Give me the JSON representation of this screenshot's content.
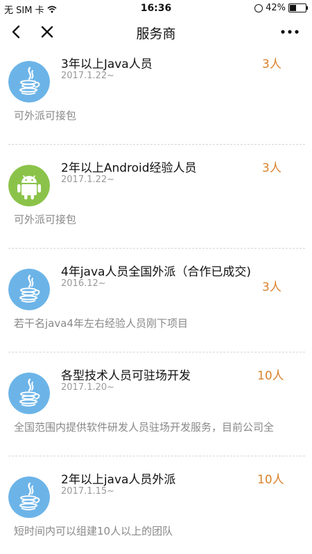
{
  "status_bar": {
    "carrier": "无 SIM 卡",
    "time": "16:36",
    "battery": "42%"
  },
  "nav": {
    "title": "服务商"
  },
  "colors": {
    "count": "#d9822b",
    "java_avatar_bg": "#6cb4e8",
    "android_avatar_bg": "#8bc34a"
  },
  "items": [
    {
      "icon": "java-icon",
      "title": "3年以上Java人员",
      "date": "2017.1.22~",
      "count": "3人",
      "desc": "可外派可接包"
    },
    {
      "icon": "android-icon",
      "title": "2年以上Android经验人员",
      "date": "2017.1.22~",
      "count": "3人",
      "desc": "可外派可接包"
    },
    {
      "icon": "java-icon",
      "title": "4年java人员全国外派（合作已成交)",
      "date": "2016.12~",
      "count": "3人",
      "desc": "若干名java4年左右经验人员刚下项目"
    },
    {
      "icon": "java-icon",
      "title": "各型技术人员可驻场开发",
      "date": "2017.1.20~",
      "count": "10人",
      "desc": "全国范围内提供软件研发人员驻场开发服务，目前公司全"
    },
    {
      "icon": "java-icon",
      "title": "2年以上java人员外派",
      "date": "2017.1.15~",
      "count": "10人",
      "desc": "短时间内可以组建10人以上的团队"
    }
  ]
}
